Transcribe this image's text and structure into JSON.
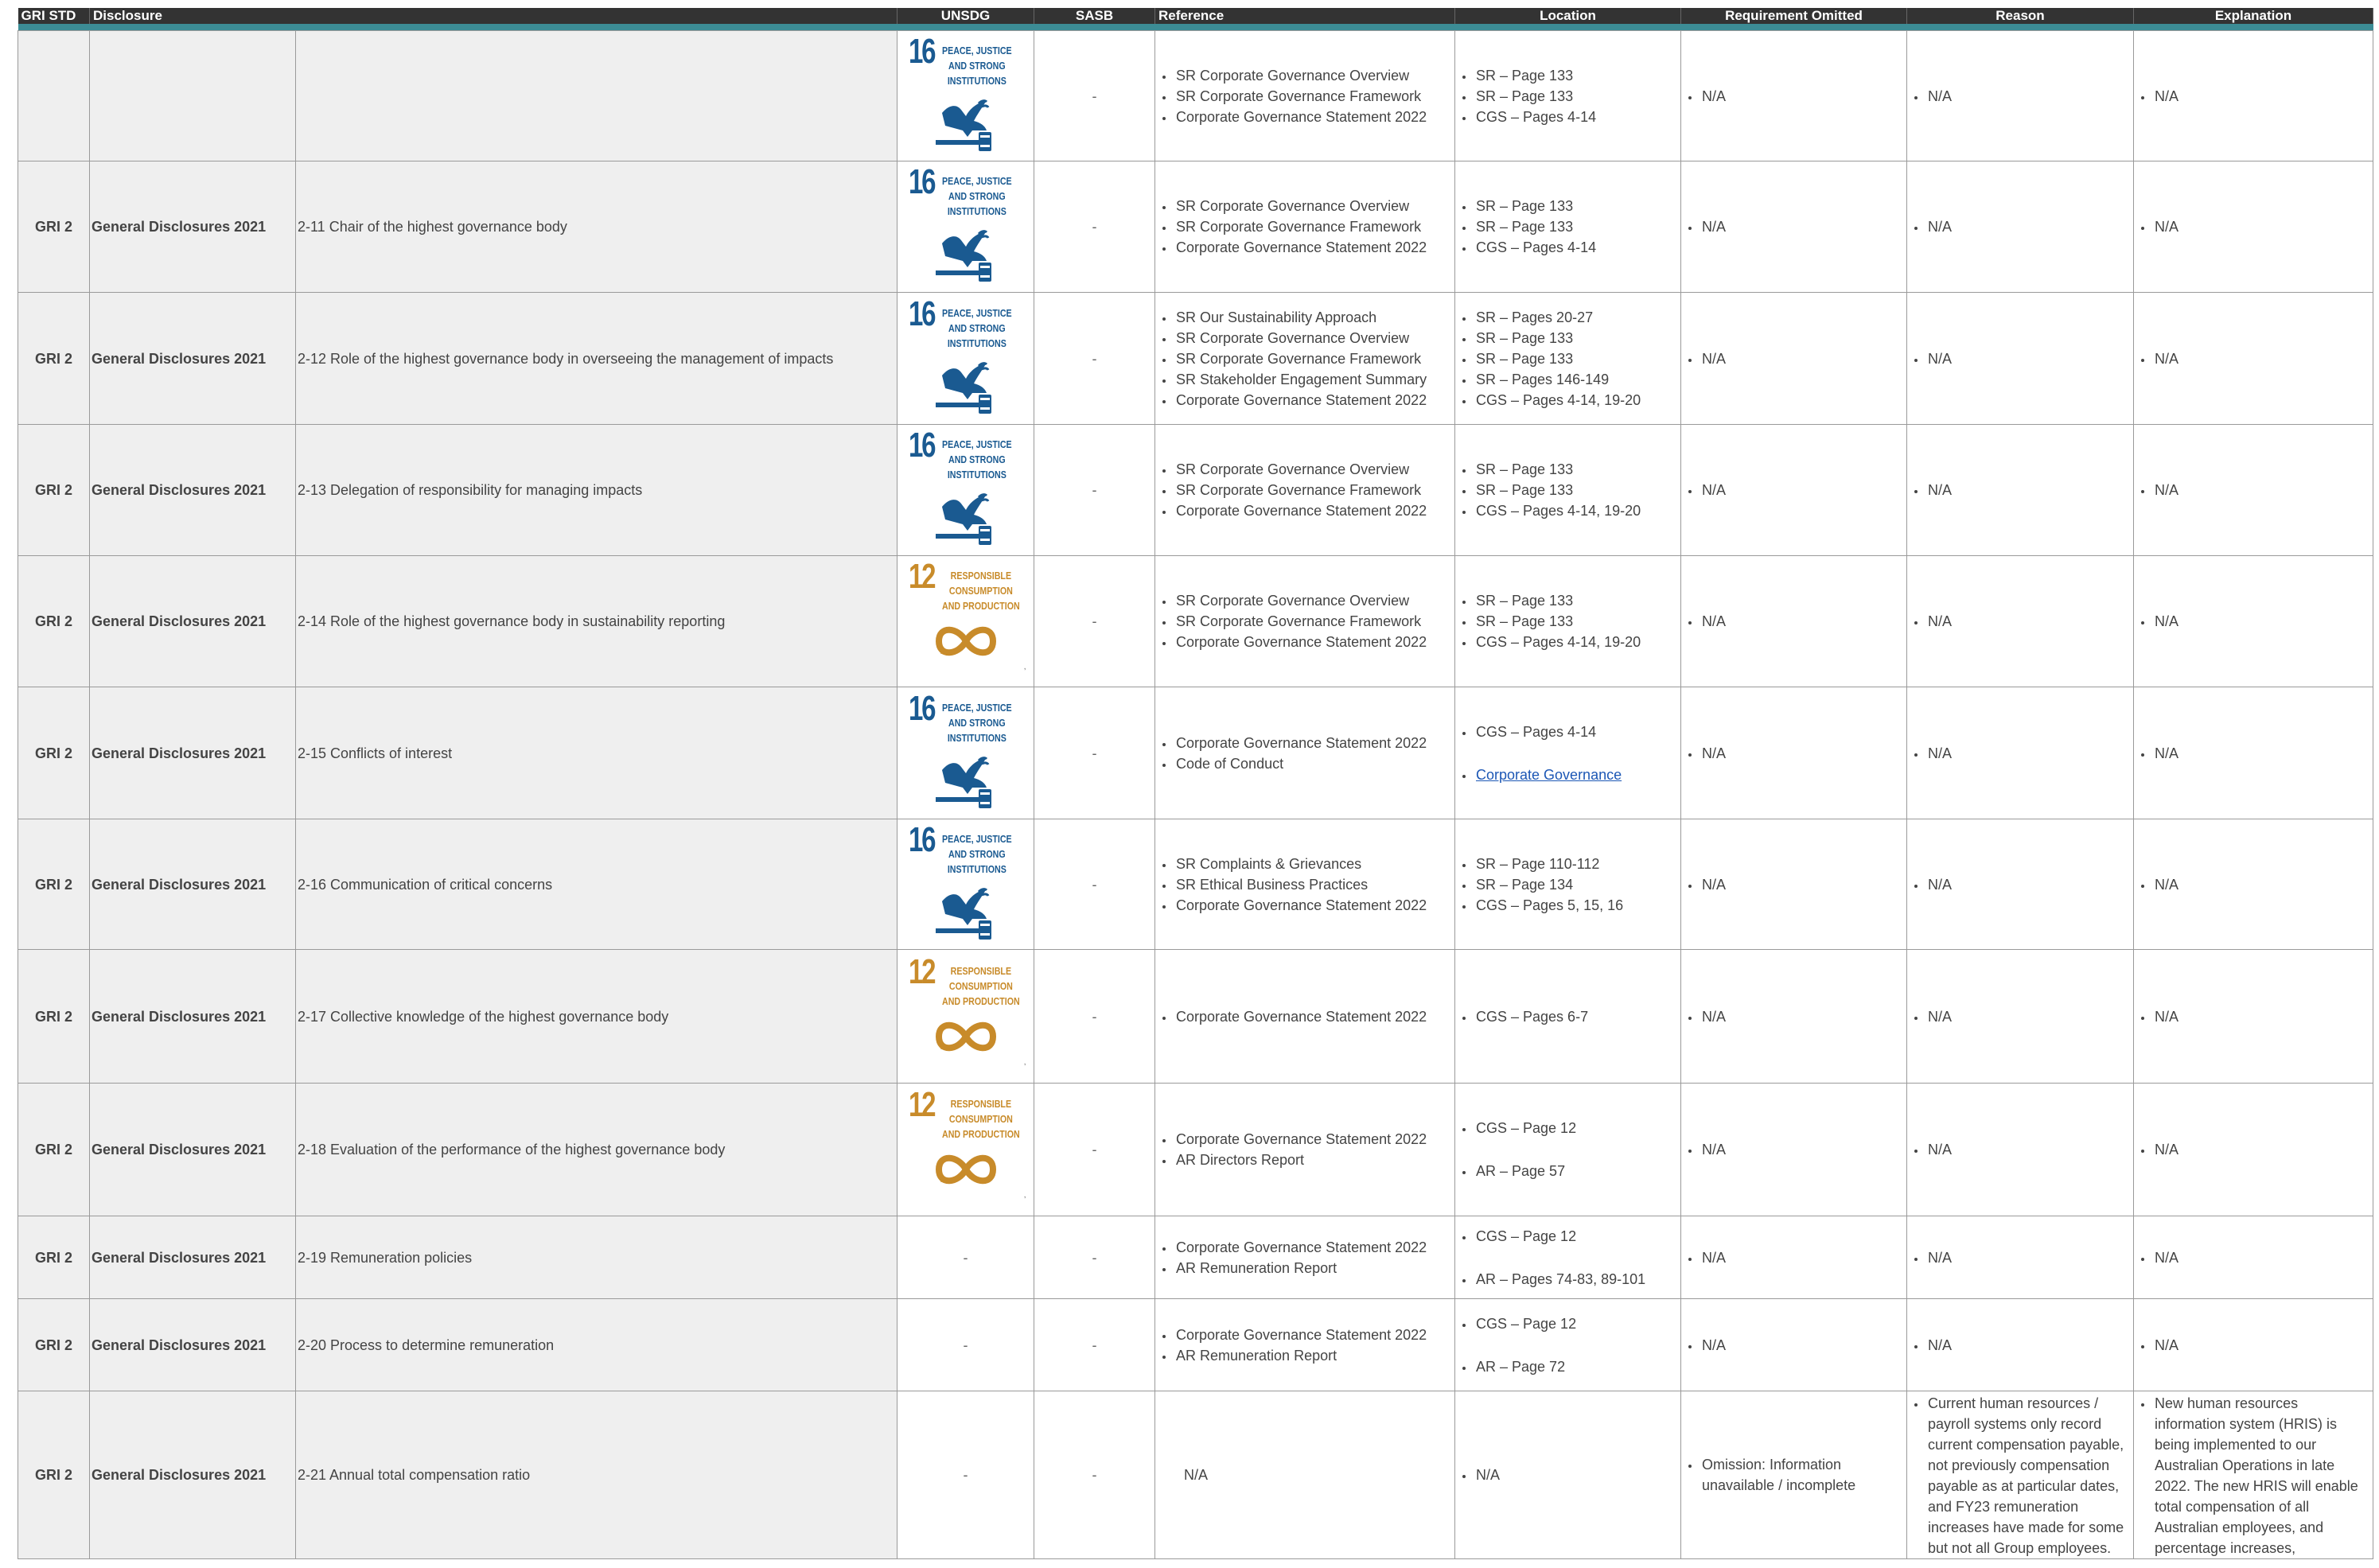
{
  "headers": {
    "gri_std": "GRI STD",
    "disclosure": "Disclosure",
    "unsdg": "UNSDG",
    "sasb": "SASB",
    "reference": "Reference",
    "location": "Location",
    "requirement_omitted": "Requirement Omitted",
    "reason": "Reason",
    "explanation": "Explanation"
  },
  "sdg_tiles": {
    "16": {
      "number": "16",
      "title_lines": [
        "PEACE, JUSTICE",
        "AND STRONG",
        "INSTITUTIONS"
      ],
      "color": "#1a5a91",
      "icon": "dove-gavel-icon"
    },
    "12": {
      "number": "12",
      "title_lines": [
        "RESPONSIBLE",
        "CONSUMPTION",
        "AND PRODUCTION"
      ],
      "color": "#c88b2a",
      "icon": "infinity-loop-icon"
    }
  },
  "rows": [
    {
      "std": "",
      "group": "",
      "disclosure": "",
      "sdg": "16",
      "sasb": "-",
      "reference": [
        "SR Corporate Governance Overview",
        "SR Corporate Governance Framework",
        "Corporate Governance Statement 2022"
      ],
      "location": [
        "SR – Page 133",
        "SR – Page 133",
        "CGS – Pages 4-14"
      ],
      "omitted": "N/A",
      "reason": "N/A",
      "explanation": "N/A"
    },
    {
      "std": "GRI 2",
      "group": "General Disclosures 2021",
      "disclosure": "2-11 Chair of the highest governance body",
      "sdg": "16",
      "sasb": "-",
      "reference": [
        "SR Corporate Governance Overview",
        "SR Corporate Governance Framework",
        "Corporate Governance Statement 2022"
      ],
      "location": [
        "SR – Page 133",
        "SR – Page 133",
        "CGS – Pages 4-14"
      ],
      "omitted": "N/A",
      "reason": "N/A",
      "explanation": "N/A"
    },
    {
      "std": "GRI 2",
      "group": "General Disclosures 2021",
      "disclosure": "2-12 Role of the highest governance body in overseeing the management of impacts",
      "sdg": "16",
      "sasb": "-",
      "reference": [
        "SR Our Sustainability Approach",
        "SR Corporate Governance Overview",
        "SR Corporate Governance Framework",
        "SR Stakeholder Engagement Summary",
        "Corporate Governance Statement 2022"
      ],
      "location": [
        "SR – Pages 20-27",
        "SR – Page 133",
        "SR – Page 133",
        "SR – Pages 146-149",
        "CGS – Pages 4-14, 19-20"
      ],
      "omitted": "N/A",
      "reason": "N/A",
      "explanation": "N/A"
    },
    {
      "std": "GRI 2",
      "group": "General Disclosures 2021",
      "disclosure": "2-13 Delegation of responsibility for managing impacts",
      "sdg": "16",
      "sasb": "-",
      "reference": [
        "SR Corporate Governance Overview",
        "SR Corporate Governance Framework",
        "Corporate Governance Statement 2022"
      ],
      "location": [
        "SR – Page 133",
        "SR – Page 133",
        "CGS – Pages 4-14, 19-20"
      ],
      "omitted": "N/A",
      "reason": "N/A",
      "explanation": "N/A"
    },
    {
      "std": "GRI 2",
      "group": "General Disclosures 2021",
      "disclosure": "2-14 Role of the highest governance body in sustainability reporting",
      "sdg": "12",
      "sasb": "-",
      "reference": [
        "SR Corporate Governance Overview",
        "SR Corporate Governance Framework",
        "Corporate Governance Statement 2022"
      ],
      "location": [
        "SR – Page 133",
        "SR – Page 133",
        "CGS – Pages 4-14, 19-20"
      ],
      "omitted": "N/A",
      "reason": "N/A",
      "explanation": "N/A"
    },
    {
      "std": "GRI 2",
      "group": "General Disclosures 2021",
      "disclosure": "2-15 Conflicts of interest",
      "sdg": "16",
      "sasb": "-",
      "reference": [
        "Corporate Governance Statement 2022",
        "Code of Conduct"
      ],
      "location": [
        "CGS – Pages 4-14",
        "Corporate Governance"
      ],
      "location_link_index": 1,
      "location_spaced": true,
      "omitted": "N/A",
      "reason": "N/A",
      "explanation": "N/A"
    },
    {
      "std": "GRI 2",
      "group": "General Disclosures 2021",
      "disclosure": "2-16 Communication of critical concerns",
      "sdg": "16",
      "sasb": "-",
      "reference": [
        "SR Complaints & Grievances",
        "SR Ethical Business Practices",
        "Corporate Governance Statement 2022"
      ],
      "location": [
        "SR – Page 110-112",
        "SR – Page 134",
        "CGS – Pages 5, 15, 16"
      ],
      "omitted": "N/A",
      "reason": "N/A",
      "explanation": "N/A"
    },
    {
      "std": "GRI 2",
      "group": "General Disclosures 2021",
      "disclosure": "2-17 Collective knowledge of the highest governance body",
      "sdg": "12",
      "sasb": "-",
      "reference": [
        "Corporate Governance Statement 2022"
      ],
      "location": [
        "CGS – Pages 6-7"
      ],
      "omitted": "N/A",
      "reason": "N/A",
      "explanation": "N/A"
    },
    {
      "std": "GRI 2",
      "group": "General Disclosures 2021",
      "disclosure": "2-18 Evaluation of the performance of the highest governance body",
      "sdg": "12",
      "sasb": "-",
      "reference": [
        "Corporate Governance Statement 2022",
        "AR Directors Report"
      ],
      "location": [
        "CGS – Page 12",
        "AR – Page 57"
      ],
      "location_spaced": true,
      "omitted": "N/A",
      "reason": "N/A",
      "explanation": "N/A"
    },
    {
      "std": "GRI 2",
      "group": "General Disclosures 2021",
      "disclosure": "2-19 Remuneration policies",
      "sdg": "-",
      "sasb": "-",
      "reference": [
        "Corporate Governance Statement 2022",
        "AR Remuneration Report"
      ],
      "location": [
        "CGS – Page 12",
        "AR – Pages 74-83, 89-101"
      ],
      "location_spaced": true,
      "omitted": "N/A",
      "reason": "N/A",
      "explanation": "N/A"
    },
    {
      "std": "GRI 2",
      "group": "General Disclosures 2021",
      "disclosure": "2-20 Process to determine remuneration",
      "sdg": "-",
      "sasb": "-",
      "reference": [
        "Corporate Governance Statement 2022",
        "AR Remuneration Report"
      ],
      "location": [
        "CGS – Page 12",
        "AR – Page 72"
      ],
      "location_spaced": true,
      "omitted": "N/A",
      "reason": "N/A",
      "explanation": "N/A"
    },
    {
      "std": "GRI 2",
      "group": "General Disclosures 2021",
      "disclosure": "2-21 Annual total compensation ratio",
      "sdg": "-",
      "sasb": "-",
      "reference_plain": "N/A",
      "location": [
        "N/A"
      ],
      "omitted": "Omission: Information unavailable / incomplete",
      "reason": "Current human resources / payroll systems only record current compensation payable, not previously compensation payable as at particular dates, and FY23 remuneration increases have made for some but not all Group employees.",
      "explanation": "New human resources information system (HRIS) is being implemented to our Australian Operations in late 2022. The new HRIS will enable total compensation of all Australian employees, and percentage increases,"
    }
  ]
}
